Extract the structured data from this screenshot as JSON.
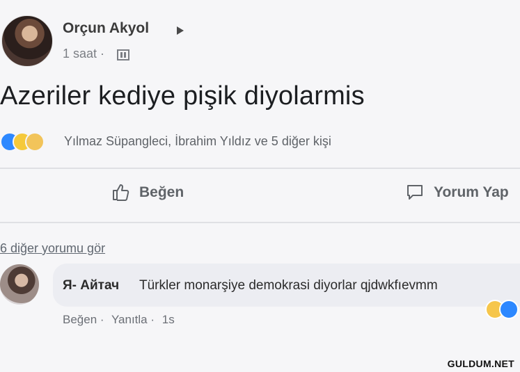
{
  "post": {
    "author": "Orçun Akyol",
    "time": "1 saat ·",
    "text": "Azeriler kediye pişik diyolarmis",
    "reactions_text": "Yılmaz Süpangleci, İbrahim Yıldız ve 5 diğer kişi",
    "actions": {
      "like": "Beğen",
      "comment": "Yorum Yap"
    },
    "more_comments": "6 diğer yorumu gör"
  },
  "comment": {
    "author": "Я- Айтач",
    "text": "Türkler monarşiye demokrasi diyorlar qjdwkfıevmm",
    "actions": [
      "Beğen ·",
      "Yanıtla ·",
      "1s"
    ]
  },
  "watermark": "GULDUM.NET",
  "colors": {
    "like_blue": "#2d88ff",
    "haha_yellow": "#f5c93b",
    "bubble_bg": "#ecedf2"
  }
}
